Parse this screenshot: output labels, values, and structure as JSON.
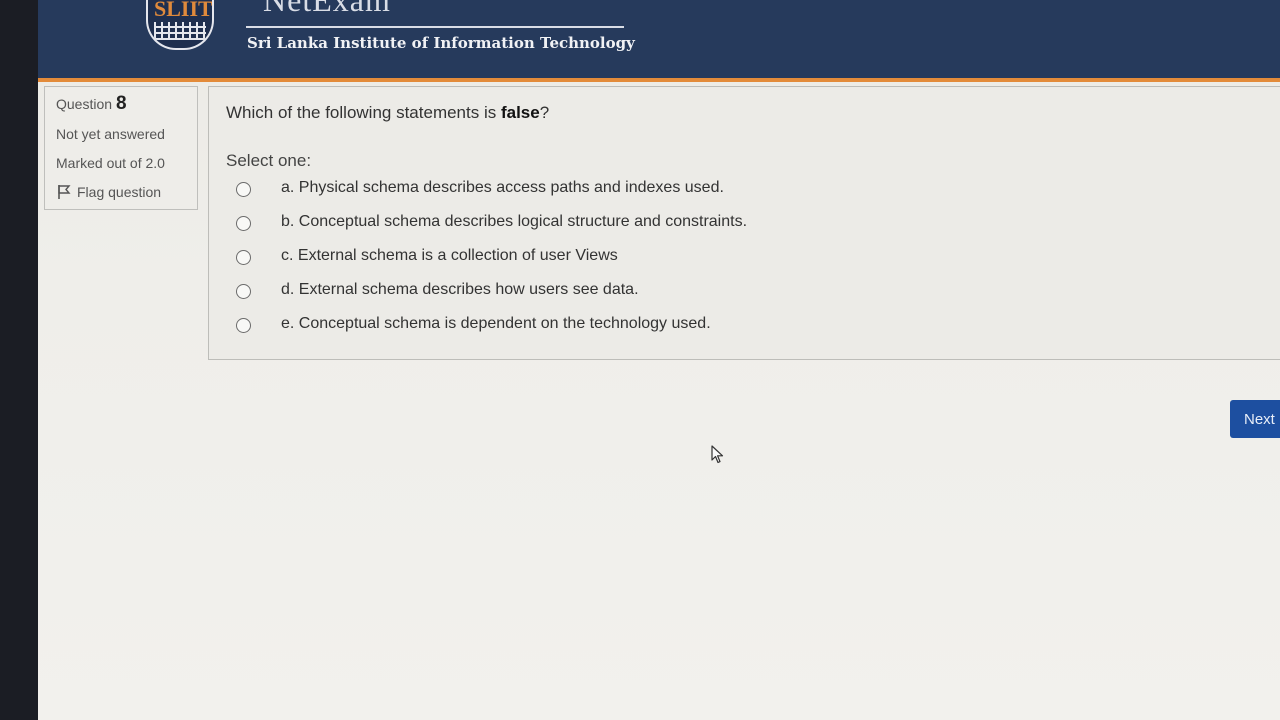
{
  "header": {
    "logo_text": "SLIIT",
    "brand_title": "NetExam",
    "institute": "Sri Lanka Institute of Information Technology",
    "colors": {
      "header_bg": "#263a5c",
      "accent": "#e38b3a"
    }
  },
  "question_info": {
    "question_label": "Question",
    "question_number": "8",
    "status": "Not yet answered",
    "marks": "Marked out of 2.0",
    "flag_label": "Flag question",
    "flag_icon": "flag-icon"
  },
  "question": {
    "prefix": "Which of the following statements is ",
    "emphasis": "false",
    "suffix": "?",
    "select_label": "Select one:",
    "options": [
      {
        "label": "a. Physical schema describes access paths and indexes used.",
        "selected": false
      },
      {
        "label": "b. Conceptual schema describes logical structure and constraints.",
        "selected": false
      },
      {
        "label": "c. External schema is a collection of user Views",
        "selected": false
      },
      {
        "label": "d. External schema describes how users see data.",
        "selected": false
      },
      {
        "label": "e. Conceptual schema is dependent on the technology used.",
        "selected": false
      }
    ]
  },
  "navigation": {
    "next_label": "Next",
    "next_color": "#1d4fa0"
  }
}
